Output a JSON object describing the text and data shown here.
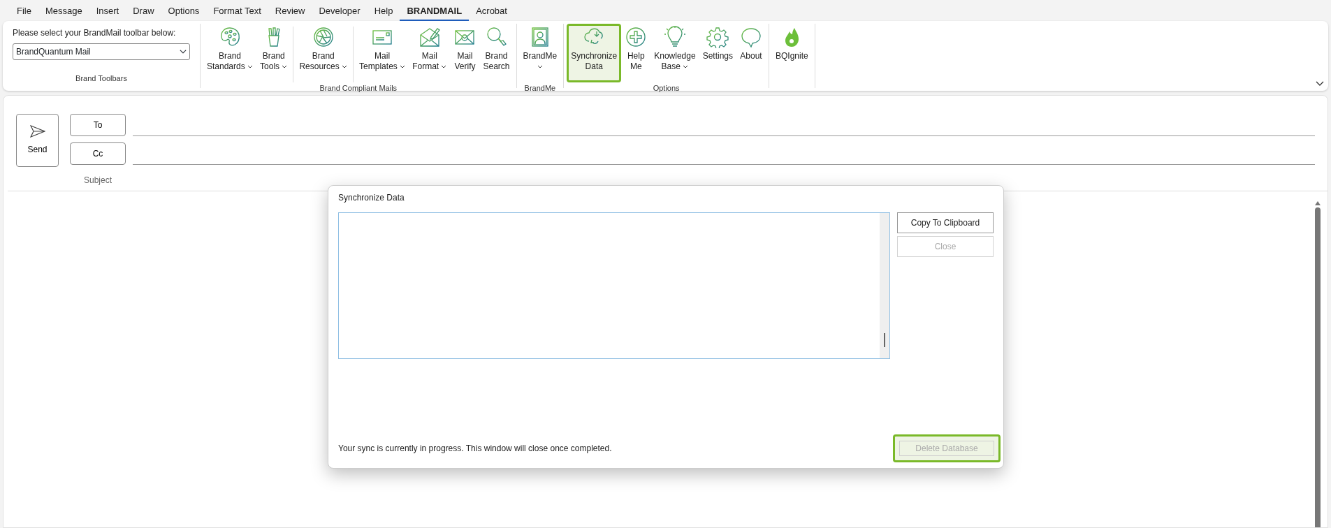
{
  "menu_tabs": [
    {
      "label": "File",
      "selected": false
    },
    {
      "label": "Message",
      "selected": false
    },
    {
      "label": "Insert",
      "selected": false
    },
    {
      "label": "Draw",
      "selected": false
    },
    {
      "label": "Options",
      "selected": false
    },
    {
      "label": "Format Text",
      "selected": false
    },
    {
      "label": "Review",
      "selected": false
    },
    {
      "label": "Developer",
      "selected": false
    },
    {
      "label": "Help",
      "selected": false
    },
    {
      "label": "BRANDMAIL",
      "selected": true
    },
    {
      "label": "Acrobat",
      "selected": false
    }
  ],
  "ribbon": {
    "toolbar_picker": {
      "label": "Please select your BrandMail toolbar below:",
      "value": "BrandQuantum Mail",
      "group": "Brand Toolbars"
    },
    "groups": [
      {
        "name": "Brand Compliant Mails",
        "items": [
          {
            "lines": [
              "Brand",
              "Standards"
            ],
            "dropdown": true,
            "highlighted": false
          },
          {
            "lines": [
              "Brand",
              "Tools"
            ],
            "dropdown": true,
            "highlighted": false
          },
          {
            "lines": [
              "Brand",
              "Resources"
            ],
            "dropdown": true,
            "highlighted": false,
            "separator_before": true
          },
          {
            "lines": [
              "Mail",
              "Templates"
            ],
            "dropdown": true,
            "highlighted": false,
            "separator_before": true
          },
          {
            "lines": [
              "Mail",
              "Format"
            ],
            "dropdown": true,
            "highlighted": false
          },
          {
            "lines": [
              "Mail",
              "Verify"
            ],
            "dropdown": false,
            "highlighted": false
          },
          {
            "lines": [
              "Brand",
              "Search"
            ],
            "dropdown": false,
            "highlighted": false
          }
        ]
      },
      {
        "name": "BrandMe",
        "items": [
          {
            "lines": [
              "BrandMe"
            ],
            "dropdown": true,
            "highlighted": false
          }
        ]
      },
      {
        "name": "Options",
        "items": [
          {
            "lines": [
              "Synchronize",
              "Data"
            ],
            "dropdown": false,
            "highlighted": true
          },
          {
            "lines": [
              "Help",
              "Me"
            ],
            "dropdown": false,
            "highlighted": false
          },
          {
            "lines": [
              "Knowledge",
              "Base"
            ],
            "dropdown": true,
            "highlighted": false
          },
          {
            "lines": [
              "Settings"
            ],
            "dropdown": false,
            "highlighted": false
          },
          {
            "lines": [
              "About"
            ],
            "dropdown": false,
            "highlighted": false
          }
        ]
      },
      {
        "items": [
          {
            "lines": [
              "BQIgnite"
            ],
            "dropdown": false,
            "highlighted": false
          }
        ]
      }
    ]
  },
  "compose": {
    "send": "Send",
    "to": "To",
    "cc": "Cc",
    "subject": "Subject"
  },
  "dialog": {
    "title": "Synchronize Data",
    "buttons": [
      {
        "label": "Copy To Clipboard",
        "disabled": false,
        "highlighted": false
      },
      {
        "label": "Close",
        "disabled": true,
        "highlighted": false
      }
    ],
    "status": "Your sync is currently in progress. This window will close once completed.",
    "footer_button": {
      "label": "Delete Database",
      "disabled": true,
      "highlighted": true
    }
  }
}
